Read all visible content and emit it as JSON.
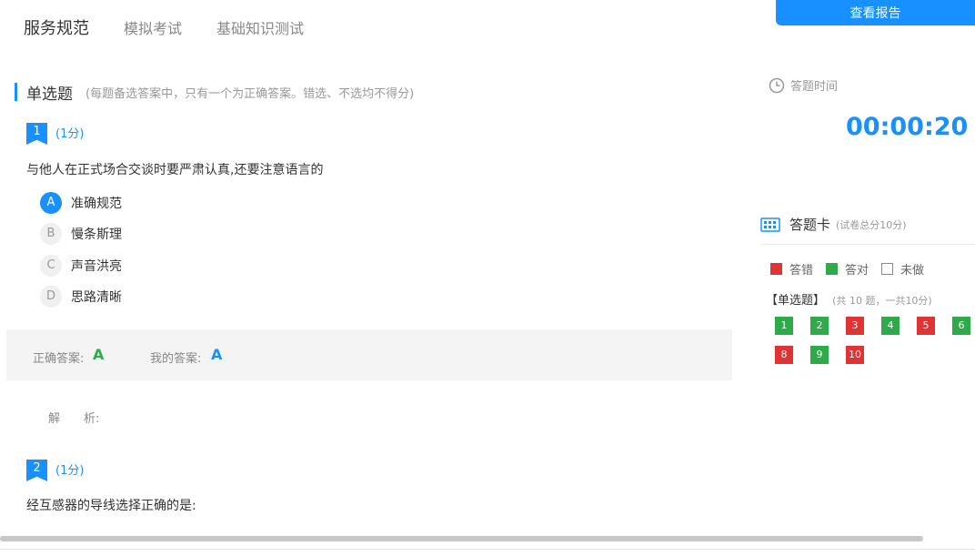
{
  "nav": {
    "items": [
      "服务规范",
      "模拟考试",
      "基础知识测试"
    ],
    "report_button": "查看报告"
  },
  "section": {
    "name": "单选题",
    "note": "(每题备选答案中，只有一个为正确答案。错选、不选均不得分)"
  },
  "questions": [
    {
      "number": "1",
      "score": "(1分)",
      "text": "与他人在正式场合交谈时要严肃认真,还要注意语言的",
      "options": [
        {
          "letter": "A",
          "text": "准确规范",
          "selected": true
        },
        {
          "letter": "B",
          "text": "慢条斯理",
          "selected": false
        },
        {
          "letter": "C",
          "text": "声音洪亮",
          "selected": false
        },
        {
          "letter": "D",
          "text": "思路清晰",
          "selected": false
        }
      ],
      "correct_label": "正确答案:",
      "correct_value": "A",
      "mine_label": "我的答案:",
      "mine_value": "A",
      "analysis_label": "解　　析:"
    },
    {
      "number": "2",
      "score": "(1分)",
      "text": "经互感器的导线选择正确的是:"
    }
  ],
  "timer": {
    "label": "答题时间",
    "value": "00:00:20"
  },
  "card": {
    "title": "答题卡",
    "subtitle": "(试卷总分10分)",
    "legend": [
      "答错",
      "答对",
      "未做"
    ],
    "group_title": "【单选题】",
    "group_sub": "(共 10 题，一共10分)",
    "cells": [
      {
        "n": "1",
        "status": "green"
      },
      {
        "n": "2",
        "status": "green"
      },
      {
        "n": "3",
        "status": "red"
      },
      {
        "n": "4",
        "status": "green"
      },
      {
        "n": "5",
        "status": "red"
      },
      {
        "n": "6",
        "status": "green"
      },
      {
        "n": "8",
        "status": "red"
      },
      {
        "n": "9",
        "status": "green"
      },
      {
        "n": "10",
        "status": "red"
      }
    ]
  },
  "colors": {
    "accent": "#1890ff",
    "correct": "#2eaa4a",
    "wrong": "#e03333"
  }
}
